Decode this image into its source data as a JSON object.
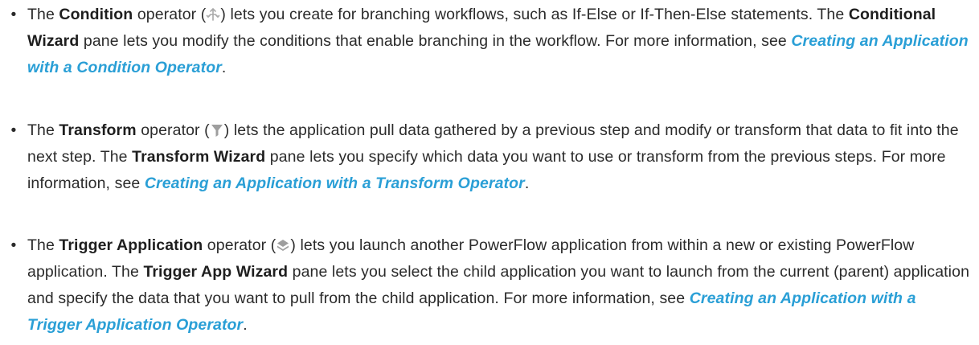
{
  "bullet_glyph": "•",
  "items": [
    {
      "icon": "condition-operator-icon",
      "pre": "The ",
      "name": "Condition",
      "mid1": " operator (",
      "mid2": ") lets you create for branching workflows, such as If-Else or If-Then-Else statements. The ",
      "wizard": "Conditional Wizard",
      "post": " pane lets you modify the conditions that enable branching in the workflow. For more information, see ",
      "link": "Creating an Application with a Condition Operator",
      "end": "."
    },
    {
      "icon": "transform-operator-icon",
      "pre": "The ",
      "name": "Transform",
      "mid1": " operator (",
      "mid2": ") lets the application pull data gathered by a previous step and modify or transform that data to fit into the next step. The ",
      "wizard": "Transform Wizard",
      "post": " pane lets you specify which data you want to use or transform from the previous steps. For more information, see ",
      "link": "Creating an Application with a Transform Operator",
      "end": "."
    },
    {
      "icon": "trigger-application-operator-icon",
      "pre": "The ",
      "name": "Trigger Application",
      "mid1": " operator (",
      "mid2": ") lets you launch another PowerFlow application from within a new or existing PowerFlow application. The ",
      "wizard": "Trigger App Wizard",
      "post": " pane lets you select the child application you want to launch from the current (parent) application and specify the data that you want to pull from the child application. For more information, see ",
      "link": "Creating an Application with a Trigger Application Operator",
      "end": "."
    }
  ],
  "colors": {
    "link": "#2a9fd6",
    "text": "#2b2b2b",
    "icon_gray": "#9e9e9e"
  }
}
